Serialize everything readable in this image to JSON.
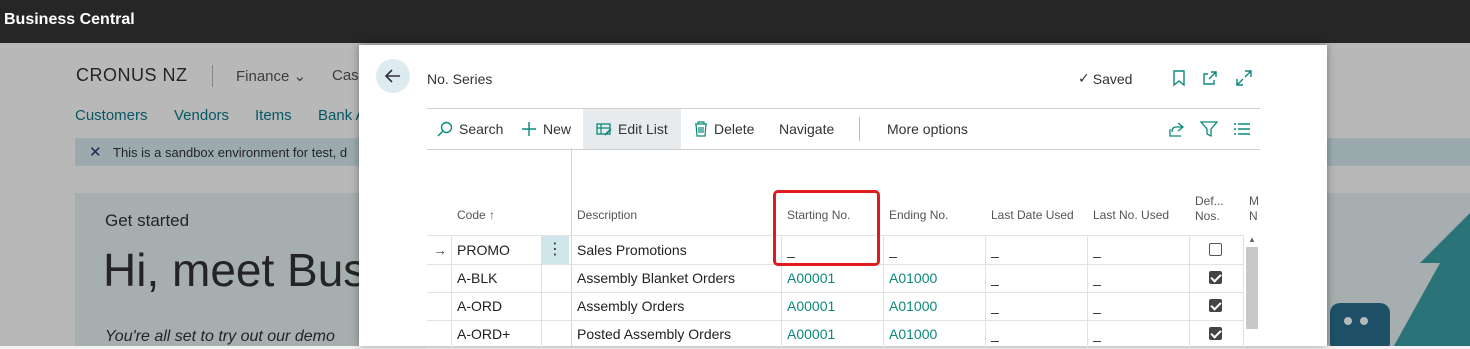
{
  "app": {
    "title": "Business Central"
  },
  "background": {
    "company": "CRONUS NZ",
    "menu": [
      "Finance",
      "Cash"
    ],
    "nav": [
      "Customers",
      "Vendors",
      "Items",
      "Bank A"
    ],
    "banner_text": "This is a sandbox environment for test, d",
    "get_started": "Get started",
    "hero_title": "Hi, meet Bus",
    "hero_sub": "You're all set to try out our demo"
  },
  "dialog": {
    "title": "No. Series",
    "status": "Saved",
    "actions": {
      "search": "Search",
      "new": "New",
      "edit_list": "Edit List",
      "delete": "Delete",
      "navigate": "Navigate",
      "more_options": "More options"
    },
    "columns": {
      "code": "Code ↑",
      "description": "Description",
      "starting_no": "Starting No.",
      "ending_no": "Ending No.",
      "last_date_used": "Last Date Used",
      "last_no_used": "Last No. Used",
      "default_nos_1": "Def...",
      "default_nos_2": "Nos.",
      "manual_1": "M",
      "manual_2": "N"
    },
    "rows": [
      {
        "code": "PROMO",
        "description": "Sales Promotions",
        "starting_no": "_",
        "ending_no": "_",
        "last_date_used": "_",
        "last_no_used": "_",
        "default_nos": false
      },
      {
        "code": "A-BLK",
        "description": "Assembly Blanket Orders",
        "starting_no": "A00001",
        "ending_no": "A01000",
        "last_date_used": "_",
        "last_no_used": "_",
        "default_nos": true
      },
      {
        "code": "A-ORD",
        "description": "Assembly Orders",
        "starting_no": "A00001",
        "ending_no": "A01000",
        "last_date_used": "_",
        "last_no_used": "_",
        "default_nos": true
      },
      {
        "code": "A-ORD+",
        "description": "Posted Assembly Orders",
        "starting_no": "A00001",
        "ending_no": "A01000",
        "last_date_used": "_",
        "last_no_used": "_",
        "default_nos": true
      }
    ]
  },
  "colors": {
    "accent": "#0a8a7a",
    "highlight": "#e01b1b",
    "topbar": "#262626"
  }
}
